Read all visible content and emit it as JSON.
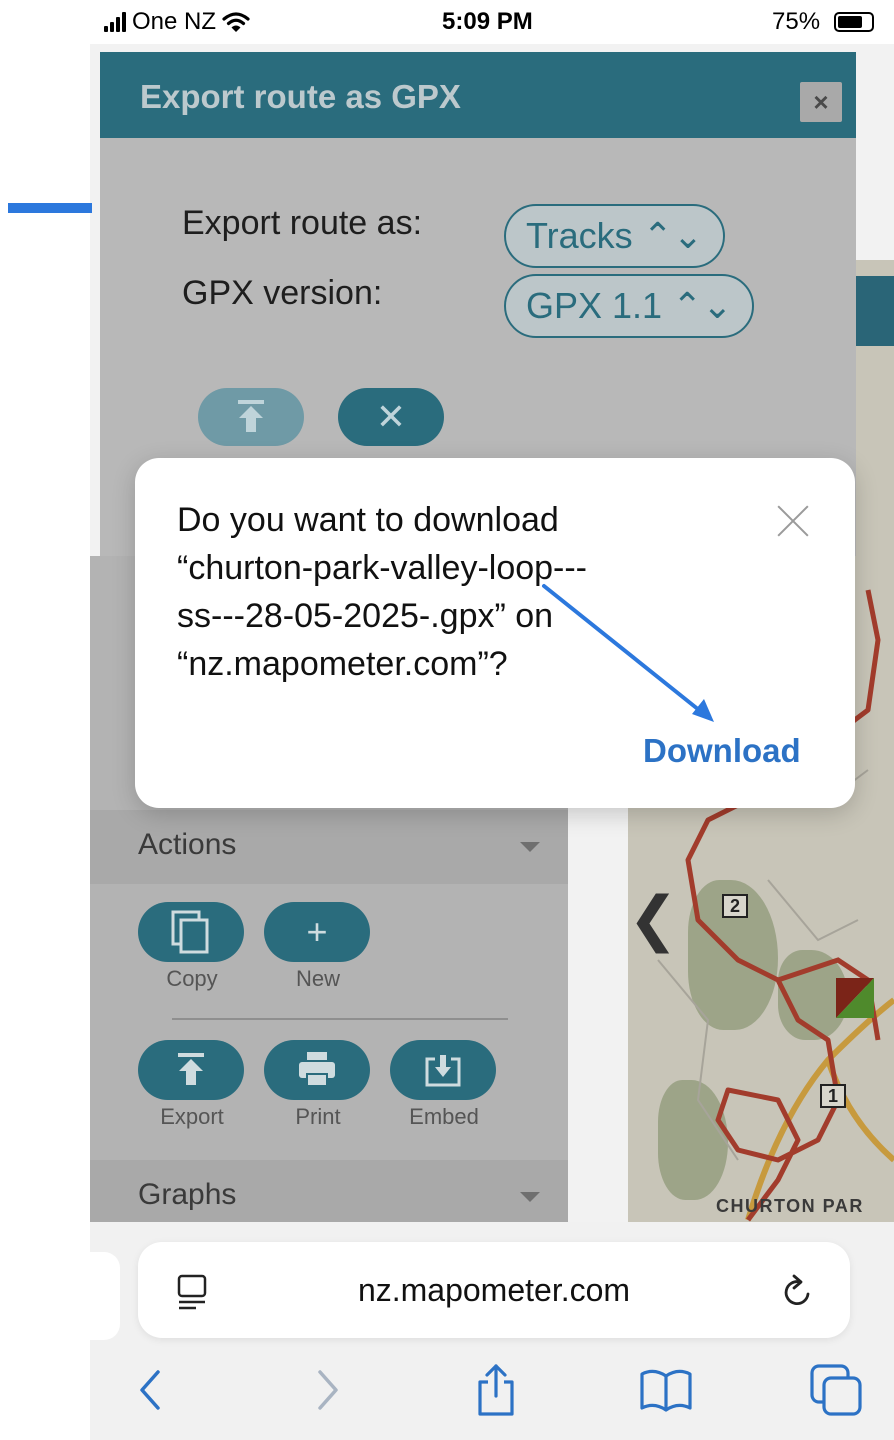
{
  "status_bar": {
    "carrier": "One NZ",
    "time": "5:09 PM",
    "battery": "75%",
    "battery_level": 0.75
  },
  "gpx_dialog": {
    "title": "Export route as GPX",
    "close_label": "×",
    "export_as_label": "Export route as:",
    "export_as_value": "Tracks ⌃⌄",
    "gpx_version_label": "GPX version:",
    "gpx_version_value": "GPX 1.1 ⌃⌄",
    "cancel_label": "✕"
  },
  "actions_panel": {
    "actions_title": "Actions",
    "copy_label": "Copy",
    "new_label": "New",
    "export_label": "Export",
    "print_label": "Print",
    "embed_label": "Embed",
    "graphs_title": "Graphs"
  },
  "map": {
    "marker_1": "1",
    "marker_2": "2",
    "place_label": "CHURTON PAR"
  },
  "download_dialog": {
    "line1": "Do you want to download",
    "line2": "“churton-park-valley-loop---",
    "line3": "ss---28-05-2025-.gpx” on",
    "line4": "“nz.mapometer.com”?",
    "download_label": "Download"
  },
  "safari": {
    "url": "nz.mapometer.com"
  },
  "colors": {
    "teal": "#2a6c7d",
    "link_blue": "#2c72c5",
    "annotation_blue": "#2c78dd",
    "route_red": "#a23c2c"
  }
}
